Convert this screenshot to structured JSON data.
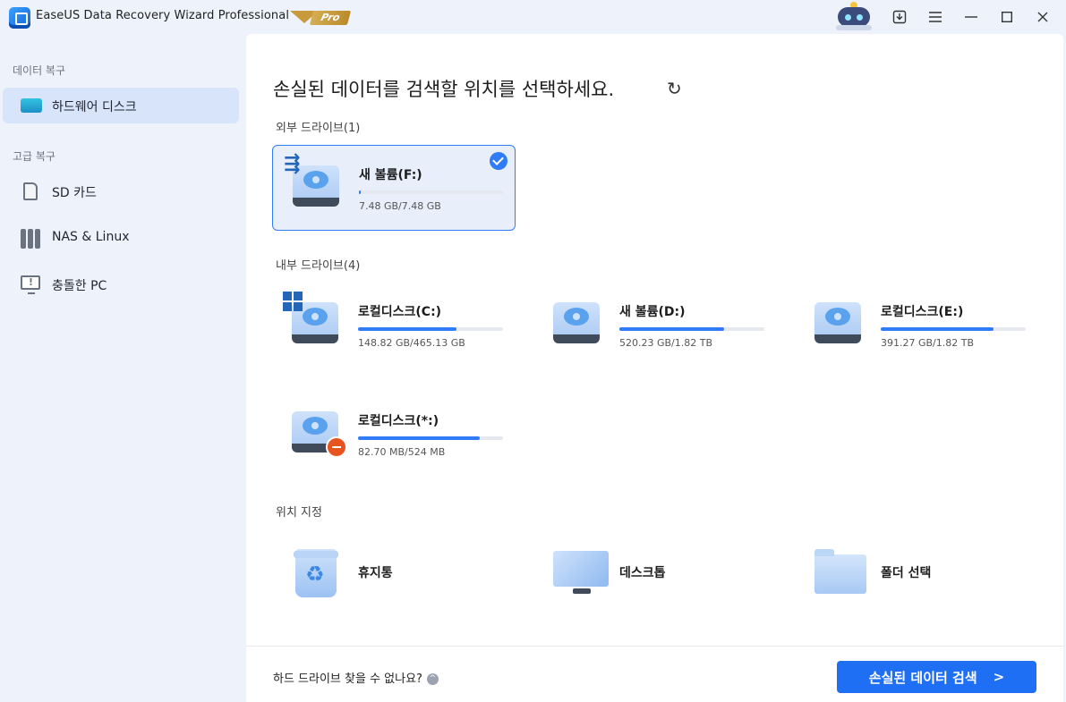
{
  "titlebar": {
    "title": "EaseUS Data Recovery Wizard Professional",
    "badge": "Pro",
    "buttons": [
      "download-icon",
      "menu-icon",
      "minimize-icon",
      "maximize-icon",
      "close-icon"
    ]
  },
  "sidebar": {
    "section_data": "데이터 복구",
    "section_advanced": "고급 복구",
    "items": [
      {
        "label": "하드웨어 디스크",
        "icon": "hard-disk-icon",
        "active": true
      },
      {
        "label": "SD 카드",
        "icon": "sd-card-icon",
        "active": false
      },
      {
        "label": "NAS & Linux",
        "icon": "nas-icon",
        "active": false
      },
      {
        "label": "충돌한 PC",
        "icon": "crashed-pc-icon",
        "active": false
      }
    ]
  },
  "main": {
    "heading": "손실된 데이터를 검색할 위치를 선택하세요.",
    "refresh_glyph": "↻",
    "external_label": "외부 드라이브(1)",
    "internal_label": "내부 드라이브(4)",
    "location_label": "위치 지정",
    "external_drives": [
      {
        "name": "새 볼륨(F:)",
        "size": "7.48 GB/7.48 GB",
        "used_fraction": 0.01,
        "selected": true
      }
    ],
    "internal_drives": [
      {
        "name": "로컬디스크(C:)",
        "size": "148.82 GB/465.13 GB",
        "used_fraction": 0.68
      },
      {
        "name": "새 볼륨(D:)",
        "size": "520.23 GB/1.82 TB",
        "used_fraction": 0.72
      },
      {
        "name": "로컬디스크(E:)",
        "size": "391.27 GB/1.82 TB",
        "used_fraction": 0.78
      },
      {
        "name": "로컬디스크(*:)",
        "size": "82.70 MB/524 MB",
        "used_fraction": 0.84
      }
    ],
    "locations": [
      {
        "label": "휴지통",
        "icon": "recycle-bin-icon"
      },
      {
        "label": "데스크톱",
        "icon": "desktop-icon"
      },
      {
        "label": "폴더 선택",
        "icon": "folder-icon"
      }
    ],
    "help_text": "하드 드라이브 찾을 수 없나요?",
    "scan_button": "손실된 데이터 검색",
    "accent_color": "#1f6ff5"
  }
}
